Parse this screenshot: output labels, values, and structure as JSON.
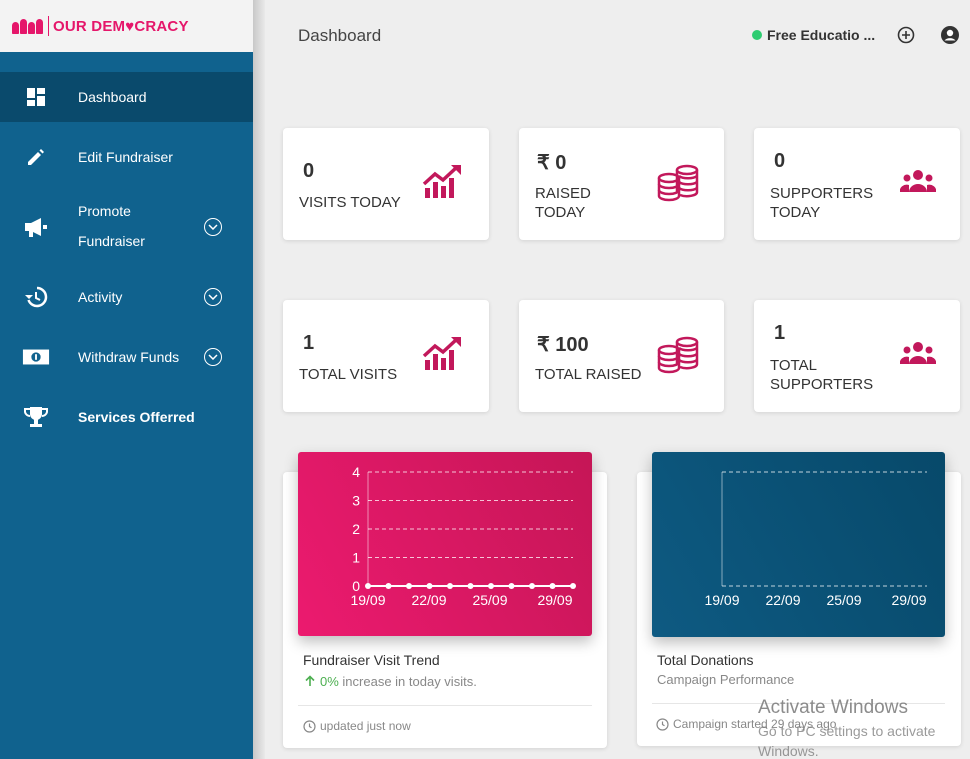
{
  "logo": {
    "text": "OUR DEM♥CRACY"
  },
  "sidebar": {
    "items": [
      {
        "label": "Dashboard",
        "icon": "dashboard-icon",
        "active": true
      },
      {
        "label": "Edit Fundraiser",
        "icon": "pencil-icon"
      },
      {
        "label_line1": "Promote",
        "label_line2": "Fundraiser",
        "icon": "megaphone-icon",
        "expandable": true
      },
      {
        "label": "Activity",
        "icon": "history-icon",
        "expandable": true
      },
      {
        "label": "Withdraw Funds",
        "icon": "money-icon",
        "expandable": true
      },
      {
        "label": "Services Offerred",
        "icon": "trophy-icon"
      }
    ]
  },
  "header": {
    "title": "Dashboard",
    "status_text": "Free Educatio ...",
    "status_color": "#2ecc71",
    "icons": [
      "add-circle-icon",
      "account-circle-icon"
    ]
  },
  "stats": [
    {
      "value": "0",
      "label": "VISITS TODAY",
      "icon": "trending-up-icon"
    },
    {
      "value": "₹ 0",
      "label_line1": "RAISED",
      "label_line2": "TODAY",
      "icon": "coins-icon"
    },
    {
      "value": "0",
      "label_line1": "SUPPORTERS",
      "label_line2": "TODAY",
      "icon": "group-icon"
    },
    {
      "value": "1",
      "label": "TOTAL VISITS",
      "icon": "trending-up-icon"
    },
    {
      "value": "₹ 100",
      "label": "TOTAL RAISED",
      "icon": "coins-icon"
    },
    {
      "value": "1",
      "label_line1": "TOTAL",
      "label_line2": "SUPPORTERS",
      "icon": "group-icon"
    }
  ],
  "charts": {
    "visits": {
      "title": "Fundraiser Visit Trend",
      "change_value": "0%",
      "change_text": " increase in today visits.",
      "footer": "updated just now"
    },
    "donations": {
      "title": "Total Donations",
      "subtitle": "Campaign Performance",
      "footer": "Campaign started 29 days ago"
    }
  },
  "chart_data": [
    {
      "type": "line",
      "y_ticks": [
        "4",
        "3",
        "2",
        "1",
        "0"
      ],
      "x_ticks": [
        "19/09",
        "22/09",
        "25/09",
        "29/09"
      ],
      "ylim": [
        0,
        4
      ],
      "values": [
        0,
        0,
        0,
        0,
        0,
        0,
        0,
        0,
        0,
        0,
        0
      ],
      "grid": true
    },
    {
      "type": "line",
      "x_ticks": [
        "19/09",
        "22/09",
        "25/09",
        "29/09"
      ],
      "values": [],
      "grid": true
    }
  ],
  "colors": {
    "sidebar": "#10628e",
    "accent": "#e5166a",
    "chart_pink": "#e91e63",
    "chart_blue": "#0e5a82"
  },
  "watermark": {
    "title": "Activate Windows",
    "subtitle": "Go to PC settings to activate Windows."
  }
}
